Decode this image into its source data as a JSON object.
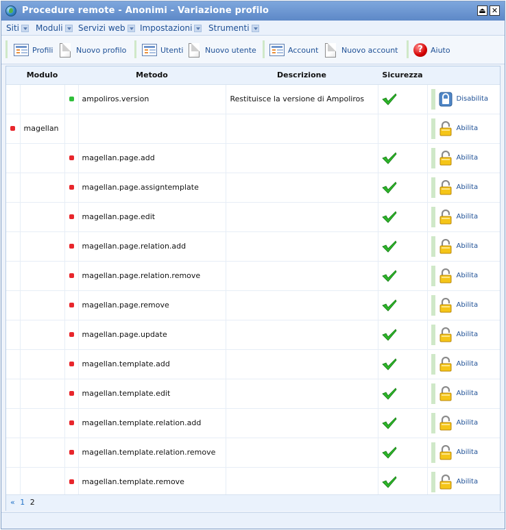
{
  "window": {
    "title": "Procedure remote - Anonimi - Variazione profilo",
    "maximize_symbol": "⏏",
    "close_symbol": "✕"
  },
  "menu": [
    {
      "label": "Siti"
    },
    {
      "label": "Moduli"
    },
    {
      "label": "Servizi web"
    },
    {
      "label": "Impostazioni"
    },
    {
      "label": "Strumenti"
    }
  ],
  "toolbar": {
    "profili": "Profili",
    "nuovo_profilo": "Nuovo profilo",
    "utenti": "Utenti",
    "nuovo_utente": "Nuovo utente",
    "account": "Account",
    "nuovo_account": "Nuovo account",
    "aiuto": "Aiuto",
    "help_glyph": "?"
  },
  "table": {
    "headers": {
      "modulo": "Modulo",
      "metodo": "Metodo",
      "descrizione": "Descrizione",
      "sicurezza": "Sicurezza"
    },
    "rows": [
      {
        "dot1": "",
        "modulo": "",
        "dot2": "green",
        "metodo": "ampoliros.version",
        "descrizione": "Restituisce la versione di Ampoliros",
        "secure": true,
        "action": "Disabilita",
        "lock": "locked"
      },
      {
        "dot1": "red",
        "modulo": "magellan",
        "dot2": "",
        "metodo": "",
        "descrizione": "",
        "secure": false,
        "action": "Abilita",
        "lock": "open"
      },
      {
        "dot1": "",
        "modulo": "",
        "dot2": "red",
        "metodo": "magellan.page.add",
        "descrizione": "",
        "secure": true,
        "action": "Abilita",
        "lock": "open"
      },
      {
        "dot1": "",
        "modulo": "",
        "dot2": "red",
        "metodo": "magellan.page.assigntemplate",
        "descrizione": "",
        "secure": true,
        "action": "Abilita",
        "lock": "open"
      },
      {
        "dot1": "",
        "modulo": "",
        "dot2": "red",
        "metodo": "magellan.page.edit",
        "descrizione": "",
        "secure": true,
        "action": "Abilita",
        "lock": "open"
      },
      {
        "dot1": "",
        "modulo": "",
        "dot2": "red",
        "metodo": "magellan.page.relation.add",
        "descrizione": "",
        "secure": true,
        "action": "Abilita",
        "lock": "open"
      },
      {
        "dot1": "",
        "modulo": "",
        "dot2": "red",
        "metodo": "magellan.page.relation.remove",
        "descrizione": "",
        "secure": true,
        "action": "Abilita",
        "lock": "open"
      },
      {
        "dot1": "",
        "modulo": "",
        "dot2": "red",
        "metodo": "magellan.page.remove",
        "descrizione": "",
        "secure": true,
        "action": "Abilita",
        "lock": "open"
      },
      {
        "dot1": "",
        "modulo": "",
        "dot2": "red",
        "metodo": "magellan.page.update",
        "descrizione": "",
        "secure": true,
        "action": "Abilita",
        "lock": "open"
      },
      {
        "dot1": "",
        "modulo": "",
        "dot2": "red",
        "metodo": "magellan.template.add",
        "descrizione": "",
        "secure": true,
        "action": "Abilita",
        "lock": "open"
      },
      {
        "dot1": "",
        "modulo": "",
        "dot2": "red",
        "metodo": "magellan.template.edit",
        "descrizione": "",
        "secure": true,
        "action": "Abilita",
        "lock": "open"
      },
      {
        "dot1": "",
        "modulo": "",
        "dot2": "red",
        "metodo": "magellan.template.relation.add",
        "descrizione": "",
        "secure": true,
        "action": "Abilita",
        "lock": "open"
      },
      {
        "dot1": "",
        "modulo": "",
        "dot2": "red",
        "metodo": "magellan.template.relation.remove",
        "descrizione": "",
        "secure": true,
        "action": "Abilita",
        "lock": "open"
      },
      {
        "dot1": "",
        "modulo": "",
        "dot2": "red",
        "metodo": "magellan.template.remove",
        "descrizione": "",
        "secure": true,
        "action": "Abilita",
        "lock": "open"
      }
    ]
  },
  "pagination": {
    "prev": "«",
    "pages": [
      "1",
      "2"
    ],
    "current": "2"
  },
  "colors": {
    "status_red": "#e8262c",
    "status_green": "#2fbf3a",
    "link_blue": "#1d4f95"
  }
}
